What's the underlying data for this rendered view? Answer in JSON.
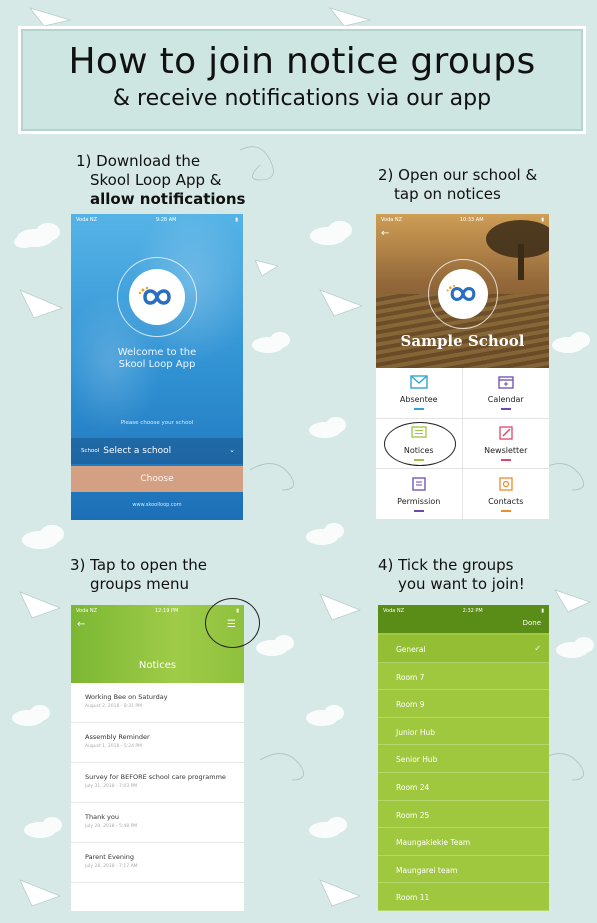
{
  "banner": {
    "title": "How to join notice groups",
    "subtitle": "& receive notifications via our app"
  },
  "steps": {
    "s1_line1": "1) Download the",
    "s1_line2": "Skool Loop App &",
    "s1_line3": "allow notifications",
    "s2_line1": "2) Open our school &",
    "s2_line2": "tap on notices",
    "s3_line1": "3) Tap to open the",
    "s3_line2": "groups menu",
    "s4_line1": "4) Tick the groups",
    "s4_line2": "you want to join!"
  },
  "phone1": {
    "status_carrier": "Voda NZ",
    "status_time": "9:28 AM",
    "welcome_line1": "Welcome to the",
    "welcome_line2": "Skool Loop App",
    "choose_prompt": "Please choose your school",
    "school_label": "School",
    "select_value": "Select a school",
    "choose_button": "Choose",
    "footer_url": "www.skoolloop.com"
  },
  "phone2": {
    "status_carrier": "Voda NZ",
    "status_time": "10:33 AM",
    "school_name": "Sample School",
    "tiles": [
      {
        "label": "Absentee",
        "color": "#2fa6d6"
      },
      {
        "label": "Calendar",
        "color": "#6a4ab0"
      },
      {
        "label": "Notices",
        "color": "#9dc43e"
      },
      {
        "label": "Newsletter",
        "color": "#e0456a"
      },
      {
        "label": "Permission",
        "color": "#6a4ab0"
      },
      {
        "label": "Contacts",
        "color": "#f08a2a"
      }
    ]
  },
  "phone3": {
    "status_carrier": "Voda NZ",
    "status_time": "12:19 PM",
    "title": "Notices",
    "notices": [
      {
        "title": "Working Bee on Saturday",
        "date": "August 2, 2018 - 8:31 PM"
      },
      {
        "title": "Assembly Reminder",
        "date": "August 1, 2018 - 5:24 PM"
      },
      {
        "title": "Survey for BEFORE school care programme",
        "date": "July 31, 2018 - 7:03 PM"
      },
      {
        "title": "Thank you",
        "date": "July 29, 2018 - 5:48 PM"
      },
      {
        "title": "Parent Evening",
        "date": "July 28, 2018 - 7:17 AM"
      }
    ]
  },
  "phone4": {
    "status_carrier": "Voda NZ",
    "status_time": "2:32 PM",
    "done_label": "Done",
    "groups": [
      {
        "label": "General",
        "selected": true
      },
      {
        "label": "Room 7",
        "selected": false
      },
      {
        "label": "Room 9",
        "selected": false
      },
      {
        "label": "Junior Hub",
        "selected": false
      },
      {
        "label": "Senior Hub",
        "selected": false
      },
      {
        "label": "Room 24",
        "selected": false
      },
      {
        "label": "Room 25",
        "selected": false
      },
      {
        "label": "Maungakiekie Team",
        "selected": false
      },
      {
        "label": "Maungarei team",
        "selected": false
      },
      {
        "label": "Room 11",
        "selected": false
      }
    ]
  },
  "colors": {
    "background": "#d6e9e6",
    "banner": "#cde6e2",
    "app_green": "#a0c83e",
    "app_blue": "#2e8fd1"
  }
}
